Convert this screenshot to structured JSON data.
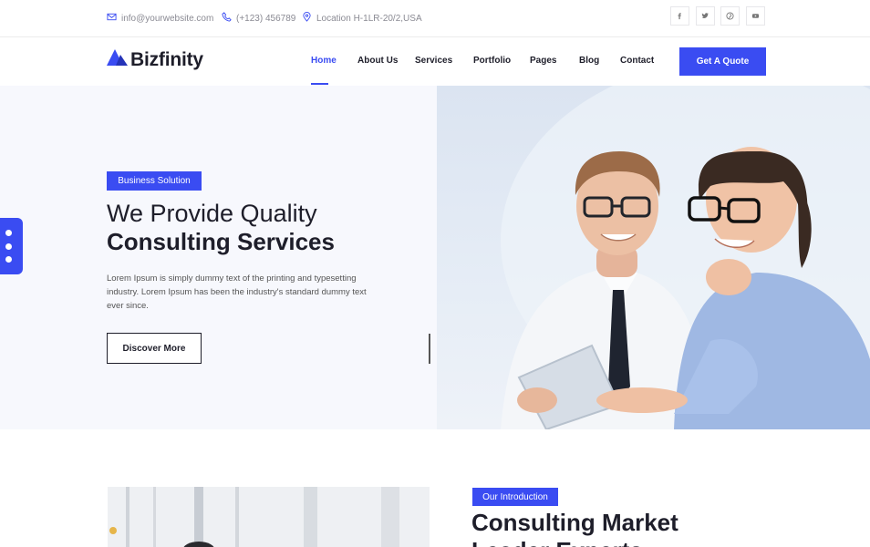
{
  "topbar": {
    "email": "info@yourwebsite.com",
    "phone": "(+123) 456789",
    "location": "Location H-1LR-20/2,USA",
    "social": [
      {
        "name": "facebook-icon",
        "glyph": "f"
      },
      {
        "name": "twitter-icon",
        "glyph": "t"
      },
      {
        "name": "pinterest-icon",
        "glyph": "p"
      },
      {
        "name": "youtube-icon",
        "glyph": "y"
      }
    ]
  },
  "header": {
    "logo": "Bizfinity",
    "nav": [
      "Home",
      "About Us",
      "Services",
      "Portfolio",
      "Pages",
      "Blog",
      "Contact"
    ],
    "active": "Home",
    "cta": "Get A Quote"
  },
  "hero": {
    "tag": "Business Solution",
    "title_line1": "We Provide Quality",
    "title_line2": "Consulting Services",
    "description": "Lorem Ipsum is simply dummy text of the printing and typesetting industry. Lorem Ipsum has been the industry's standard dummy text ever since.",
    "button": "Discover More"
  },
  "intro": {
    "tag": "Our Introduction",
    "title_line1": "Consulting Market",
    "title_line2": "Leader Experts"
  },
  "colors": {
    "accent": "#3a4cf2",
    "dark": "#1e1e2a",
    "hero_bg": "#f7f8fd"
  }
}
